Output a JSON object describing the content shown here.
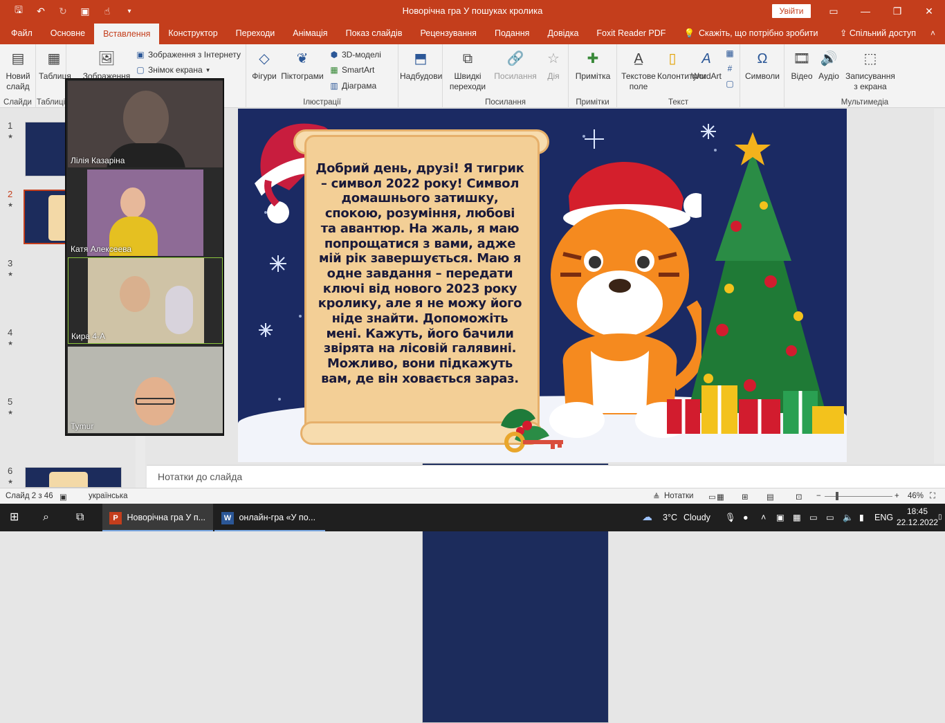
{
  "window": {
    "title": "Новорічна гра У пошуках кролика",
    "signin_label": "Увійти"
  },
  "tabs": [
    "Файл",
    "Основне",
    "Вставлення",
    "Конструктор",
    "Переходи",
    "Анімація",
    "Показ слайдів",
    "Рецензування",
    "Подання",
    "Довідка",
    "Foxit Reader PDF"
  ],
  "active_tab": "Вставлення",
  "tell_me": "Скажіть, що потрібно зробити",
  "share": "Спільний доступ",
  "ribbon": {
    "new_slide": "Новий слайд",
    "table": "Таблиця",
    "images": "Зображення",
    "online_images": "Зображення з Інтернету",
    "screenshot": "Знімок екрана",
    "shapes": "Фігури",
    "icons": "Піктограми",
    "models_3d": "3D-моделі",
    "smartart": "SmartArt",
    "chart": "Діаграма",
    "addins": "Надбудови",
    "quick_links": "Швидкі переходи",
    "link": "Посилання",
    "action": "Дія",
    "comment": "Примітка",
    "textbox": "Текстове поле",
    "header_footer": "Колонтитули",
    "wordart": "WordArt",
    "symbols": "Символи",
    "video": "Відео",
    "audio": "Аудіо",
    "screen_recording": "Записування з екрана",
    "groups": {
      "slides": "Слайди",
      "tables": "Таблиці",
      "illustrations": "Ілюстрації",
      "links": "Посилання",
      "comments": "Примітки",
      "text": "Текст",
      "media": "Мультимедіа"
    }
  },
  "slides": [
    {
      "num": "1"
    },
    {
      "num": "2"
    },
    {
      "num": "3"
    },
    {
      "num": "4"
    },
    {
      "num": "5"
    },
    {
      "num": "6"
    }
  ],
  "selected_slide": "2",
  "slide_text": "Добрий день, друзі! Я тигрик – символ 2022 року! Символ домашнього затишку, спокою, розуміння, любові та авантюр. На жаль, я маю попрощатися з вами, адже мій рік завершується. Маю я одне завдання – передати ключі від нового 2023 року кролику, але я не можу його ніде знайти. Допоможіть мені. Кажуть, його бачили звірята на лісовій галявині. Можливо, вони підкажуть вам, де він ховається зараз.",
  "participants": [
    "Лілія Казаріна",
    "Катя Алексеева",
    "Кира 4-А",
    "Tymur"
  ],
  "notes_placeholder": "Нотатки до слайда",
  "status": {
    "slide_of": "Слайд 2 з 46",
    "language": "українська",
    "notes": "Нотатки",
    "zoom": "46%"
  },
  "taskbar": {
    "ppt": "Новорічна гра У п...",
    "word": "онлайн-гра «У по...",
    "weather_temp": "3°C",
    "weather_text": "Cloudy",
    "lang": "ENG",
    "time": "18:45",
    "date": "22.12.2022"
  },
  "colors": {
    "accent": "#c43e1c",
    "slide_bg": "#1b2a63",
    "scroll": "#f3cf96"
  }
}
